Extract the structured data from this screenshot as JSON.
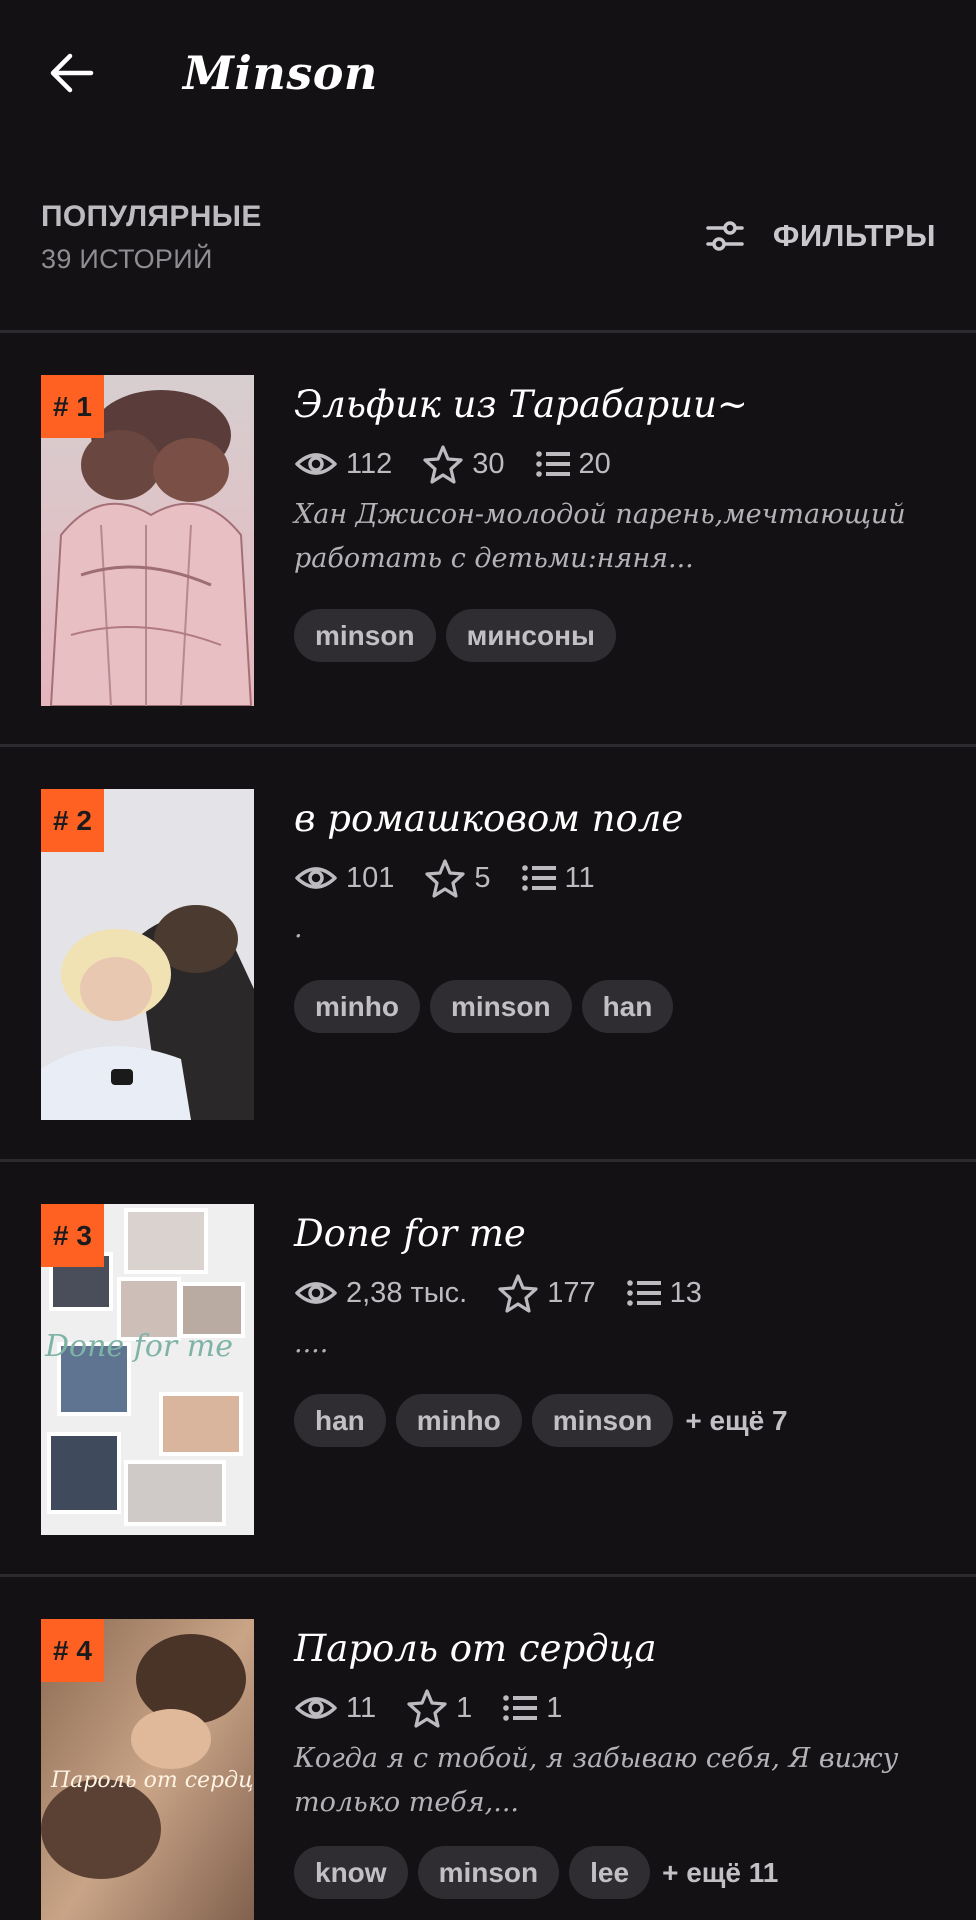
{
  "header": {
    "title": "Minson",
    "back_icon": "arrow-left-icon"
  },
  "sort": {
    "label": "ПОПУЛЯРНЫЕ",
    "count": "39 ИСТОРИЙ",
    "filter_label": "ФИЛЬТРЫ",
    "filter_icon": "sliders-icon"
  },
  "colors": {
    "background": "#131114",
    "rank_badge": "#ff6122",
    "tag_bg": "#2f2d31"
  },
  "stories": [
    {
      "rank": "# 1",
      "title": "Эльфик из Тарабарии~",
      "views": "112",
      "stars": "30",
      "parts": "20",
      "description": "Хан Джисон-молодой парень,мечтающий работать с детьми:няня...",
      "tags": [
        "minson",
        "минсоны"
      ],
      "more_tags": ""
    },
    {
      "rank": "# 2",
      "title": "в ромашковом поле",
      "views": "101",
      "stars": "5",
      "parts": "11",
      "description": ".",
      "tags": [
        "minho",
        "minson",
        "han"
      ],
      "more_tags": ""
    },
    {
      "rank": "# 3",
      "title": "Done for me",
      "views": "2,38 тыс.",
      "stars": "177",
      "parts": "13",
      "description": "....",
      "tags": [
        "han",
        "minho",
        "minson"
      ],
      "more_tags": "+ ещё 7"
    },
    {
      "rank": "# 4",
      "title": "Пароль от сердца",
      "views": "11",
      "stars": "1",
      "parts": "1",
      "description": "Когда я с тобой, я забываю себя, Я вижу только тебя,...",
      "tags": [
        "know",
        "minson",
        "lee"
      ],
      "more_tags": "+ ещё 11"
    }
  ]
}
